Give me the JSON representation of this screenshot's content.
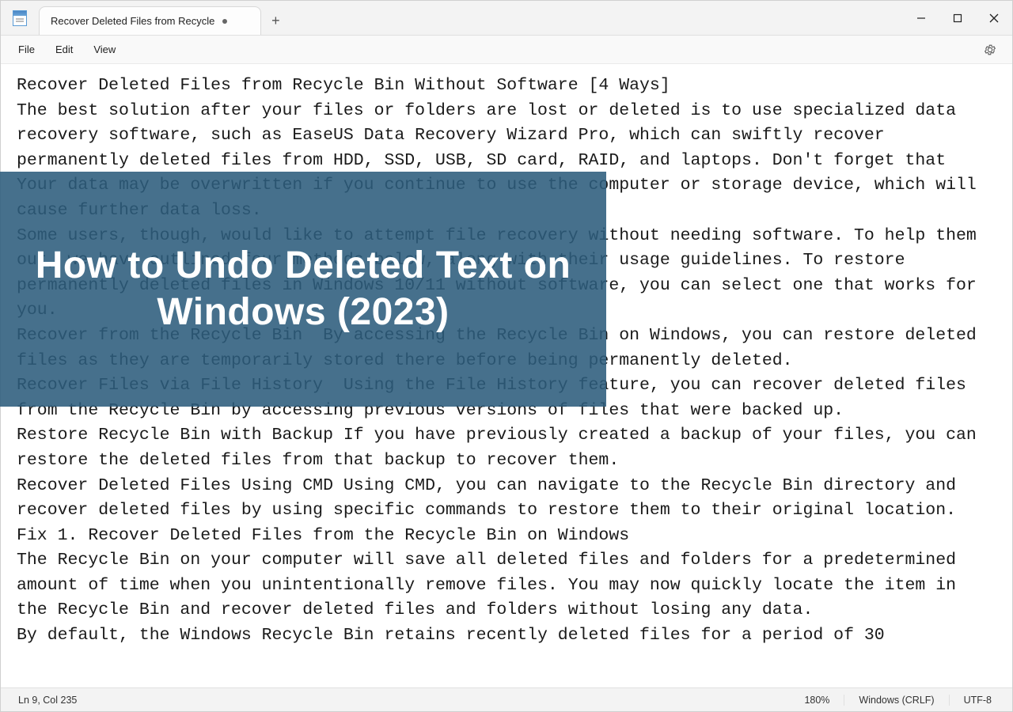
{
  "titlebar": {
    "tab_title": "Recover Deleted Files from Recycle",
    "modified_indicator": "•",
    "new_tab_label": "+"
  },
  "window_controls": {
    "minimize": "—",
    "maximize": "▢",
    "close": "✕"
  },
  "menubar": {
    "file": "File",
    "edit": "Edit",
    "view": "View"
  },
  "document": {
    "text": "Recover Deleted Files from Recycle Bin Without Software [4 Ways]\nThe best solution after your files or folders are lost or deleted is to use specialized data recovery software, such as EaseUS Data Recovery Wizard Pro, which can swiftly recover permanently deleted files from HDD, SSD, USB, SD card, RAID, and laptops. Don't forget that Your data may be overwritten if you continue to use the computer or storage device, which will cause further data loss.\nSome users, though, would like to attempt file recovery without needing software. To help them out, we have outlined four methods below, along with their usage guidelines. To restore permanently deleted files in Windows 10/11 without software, you can select one that works for you.\nRecover from the Recycle Bin  By accessing the Recycle Bin on Windows, you can restore deleted files as they are temporarily stored there before being permanently deleted.\nRecover Files via File History  Using the File History feature, you can recover deleted files from the Recycle Bin by accessing previous versions of files that were backed up.\nRestore Recycle Bin with Backup If you have previously created a backup of your files, you can restore the deleted files from that backup to recover them.\nRecover Deleted Files Using CMD Using CMD, you can navigate to the Recycle Bin directory and recover deleted files by using specific commands to restore them to their original location.\nFix 1. Recover Deleted Files from the Recycle Bin on Windows\nThe Recycle Bin on your computer will save all deleted files and folders for a predetermined amount of time when you unintentionally remove files. You may now quickly locate the item in the Recycle Bin and recover deleted files and folders without losing any data.\nBy default, the Windows Recycle Bin retains recently deleted files for a period of 30"
  },
  "statusbar": {
    "cursor_position": "Ln 9, Col 235",
    "zoom": "180%",
    "line_ending": "Windows (CRLF)",
    "encoding": "UTF-8"
  },
  "overlay": {
    "text": "How to Undo Deleted Text on Windows (2023)"
  }
}
